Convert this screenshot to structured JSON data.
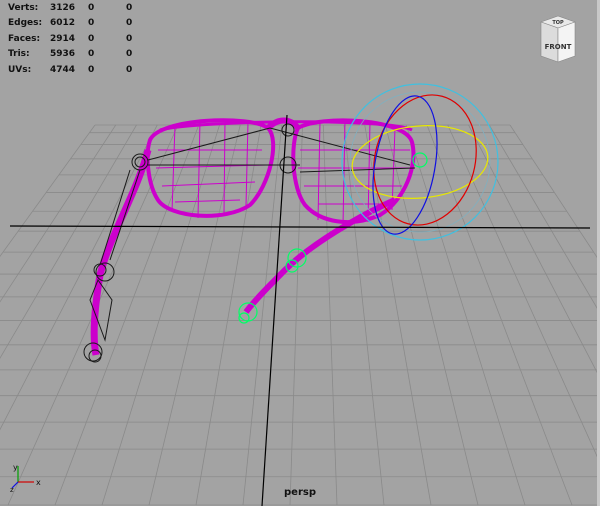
{
  "hud": {
    "rows": [
      {
        "label": "Verts:",
        "v1": "3126",
        "v2": "0",
        "v3": "0"
      },
      {
        "label": "Edges:",
        "v1": "6012",
        "v2": "0",
        "v3": "0"
      },
      {
        "label": "Faces:",
        "v1": "2914",
        "v2": "0",
        "v3": "0"
      },
      {
        "label": "Tris:",
        "v1": "5936",
        "v2": "0",
        "v3": "0"
      },
      {
        "label": "UVs:",
        "v1": "4744",
        "v2": "0",
        "v3": "0"
      }
    ]
  },
  "viewcube": {
    "top_label": "TOP",
    "front_label": "FRONT"
  },
  "camera": {
    "name": "persp"
  },
  "axis": {
    "x": "x",
    "y": "y",
    "z": "z"
  },
  "colors": {
    "background": "#a3a3a3",
    "grid": "#8a8a8a",
    "axis_lines": "#000000",
    "wire_selected": "#cc00cc",
    "joint": "#1a1a1a",
    "control": "#00ff66",
    "manip_x": "#e00000",
    "manip_y": "#e8e800",
    "manip_z": "#1010e0",
    "manip_view": "#40c0e0"
  },
  "icons": [
    "viewcube-icon",
    "axis-gizmo-icon",
    "rotate-manipulator-icon"
  ]
}
